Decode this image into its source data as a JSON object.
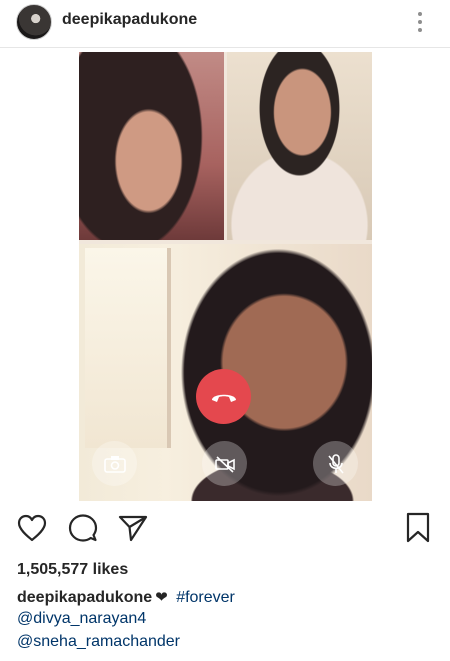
{
  "post": {
    "username": "deepikapadukone",
    "likes": "1,505,577 likes",
    "caption_user": "deepikapadukone",
    "caption_emoji": "❤",
    "hashtag": "#forever",
    "mentions": [
      "@divya_narayan4",
      "@sneha_ramachander"
    ]
  },
  "icons": {
    "more": "more-options-icon",
    "like": "heart-icon",
    "comment": "comment-icon",
    "share": "share-icon",
    "save": "bookmark-icon",
    "end_call": "end-call-icon",
    "camera": "switch-camera-icon",
    "video": "video-off-icon",
    "mic": "mic-off-icon"
  },
  "colors": {
    "text": "#262626",
    "link": "#003569",
    "end_call": "#e4484e"
  }
}
